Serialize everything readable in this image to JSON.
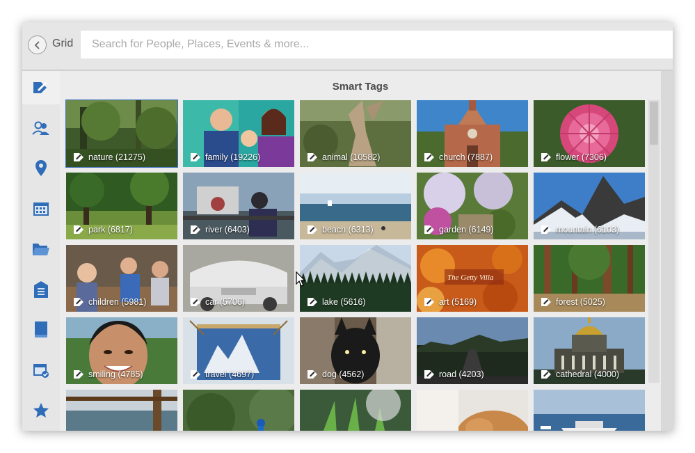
{
  "header": {
    "back_label": "Grid",
    "search_placeholder": "Search for People, Places, Events & more..."
  },
  "sidebar": {
    "items": [
      {
        "name": "smart-tags",
        "icon": "tag-icon",
        "active": true
      },
      {
        "name": "people",
        "icon": "people-icon"
      },
      {
        "name": "places",
        "icon": "location-pin-icon"
      },
      {
        "name": "events",
        "icon": "calendar-icon"
      },
      {
        "name": "folders",
        "icon": "folder-icon"
      },
      {
        "name": "documents",
        "icon": "document-icon"
      },
      {
        "name": "albums",
        "icon": "book-icon"
      },
      {
        "name": "saved-events",
        "icon": "calendar-check-icon"
      },
      {
        "name": "favorites",
        "icon": "star-icon"
      }
    ]
  },
  "panel": {
    "title": "Smart Tags",
    "tags": [
      {
        "label": "nature (21275)",
        "selected": true
      },
      {
        "label": "family (19226)"
      },
      {
        "label": "animal (10582)"
      },
      {
        "label": "church (7887)"
      },
      {
        "label": "flower (7306)"
      },
      {
        "label": "park (6817)"
      },
      {
        "label": "river (6403)"
      },
      {
        "label": "beach (6313)"
      },
      {
        "label": "garden (6149)"
      },
      {
        "label": "mountain (6103)"
      },
      {
        "label": "children (5981)"
      },
      {
        "label": "car (5706)"
      },
      {
        "label": "lake (5616)"
      },
      {
        "label": "art (5169)"
      },
      {
        "label": "forest (5025)"
      },
      {
        "label": "smiling (4785)"
      },
      {
        "label": "travel (4697)"
      },
      {
        "label": "dog (4562)"
      },
      {
        "label": "road (4203)"
      },
      {
        "label": "cathedral (4000)"
      },
      {
        "label": ""
      },
      {
        "label": ""
      },
      {
        "label": ""
      },
      {
        "label": ""
      },
      {
        "label": ""
      }
    ]
  },
  "colors": {
    "accent": "#3d70c7",
    "icon": "#2f6db8"
  }
}
